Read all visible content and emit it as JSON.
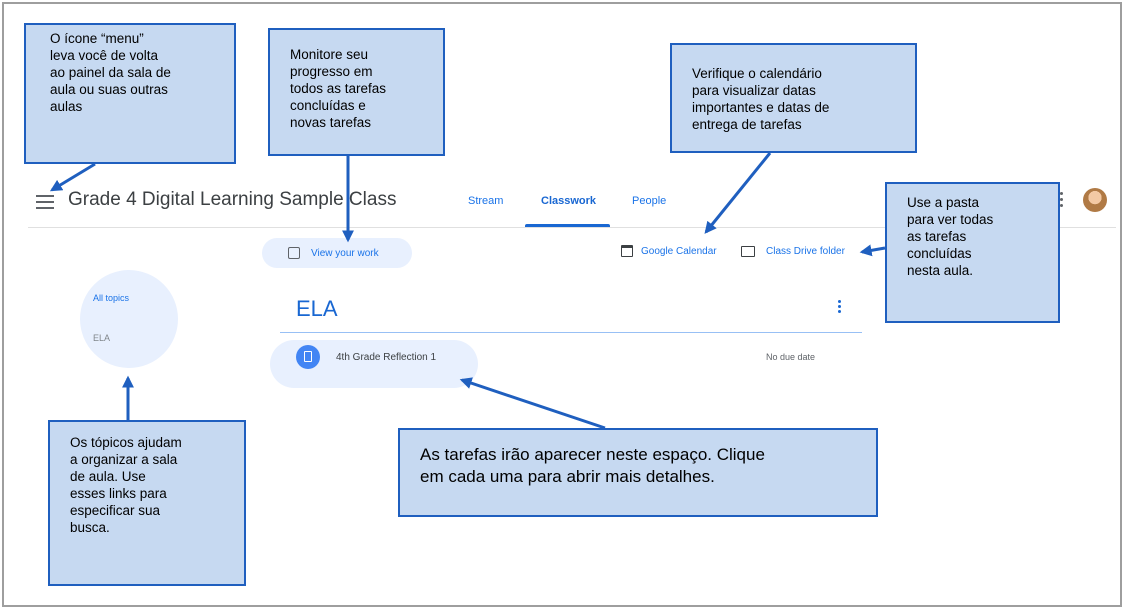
{
  "header": {
    "class_title": "Grade 4 Digital Learning Sample Class",
    "tabs": [
      {
        "label": "Stream",
        "active": false
      },
      {
        "label": "Classwork",
        "active": true
      },
      {
        "label": "People",
        "active": false
      }
    ]
  },
  "toolbar": {
    "view_work_label": "View your work",
    "calendar_label": "Google Calendar",
    "drive_label": "Class Drive folder"
  },
  "topics_nav": {
    "all_label": "All topics",
    "items": [
      "ELA"
    ]
  },
  "topic": {
    "heading": "ELA",
    "assignments": [
      {
        "title": "4th Grade Reflection 1",
        "due": "No due date"
      }
    ]
  },
  "callouts": {
    "menu": "O ícone “menu”\nleva você de volta\nao painel da sala de\naula ou suas outras\naulas",
    "progress": "Monitore seu\nprogresso em\ntodos as tarefas\nconcluídas e\nnovas tarefas",
    "calendar": "Verifique o calendário\npara visualizar datas\nimportantes e datas de\nentrega de tarefas",
    "folder": "Use a pasta\npara ver todas\nas tarefas\nconcluídas\nnesta aula.",
    "topics": "Os tópicos ajudam\na organizar a sala\nde aula. Use\nesses links para\nespecificar sua\nbusca.",
    "assignments": "As tarefas irão aparecer neste espaço. Clique\nem cada uma para abrir mais detalhes."
  },
  "colors": {
    "accent": "#1a73e8",
    "callout_fill": "#c6d9f1",
    "callout_border": "#1f5fbf",
    "highlight_fill": "#e8f0fe"
  },
  "icons": [
    "menu-icon",
    "view-work-icon",
    "calendar-icon",
    "folder-icon",
    "assignment-icon",
    "more-vert-icon",
    "apps-icon",
    "avatar"
  ]
}
